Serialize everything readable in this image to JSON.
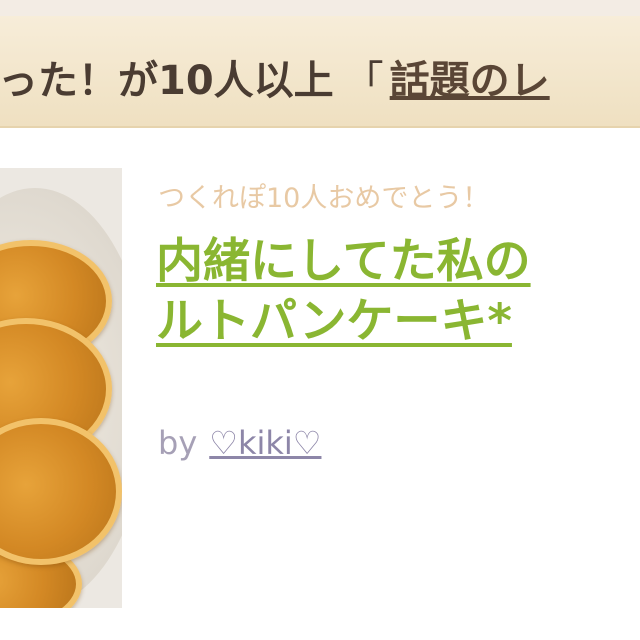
{
  "banner": {
    "text": "った！が10人以上",
    "bracket": "「",
    "link": "話題のレ"
  },
  "recipe": {
    "meta": "つくれぽ10人おめでとう！",
    "title_line1": "内緒にしてた私の",
    "title_line2": "ルトパンケーキ*",
    "by_label": "by",
    "author": "♡kiki♡"
  },
  "colors": {
    "title": "#8ab632",
    "meta": "#e8c9a4",
    "banner_bg": "#f7edd9"
  }
}
